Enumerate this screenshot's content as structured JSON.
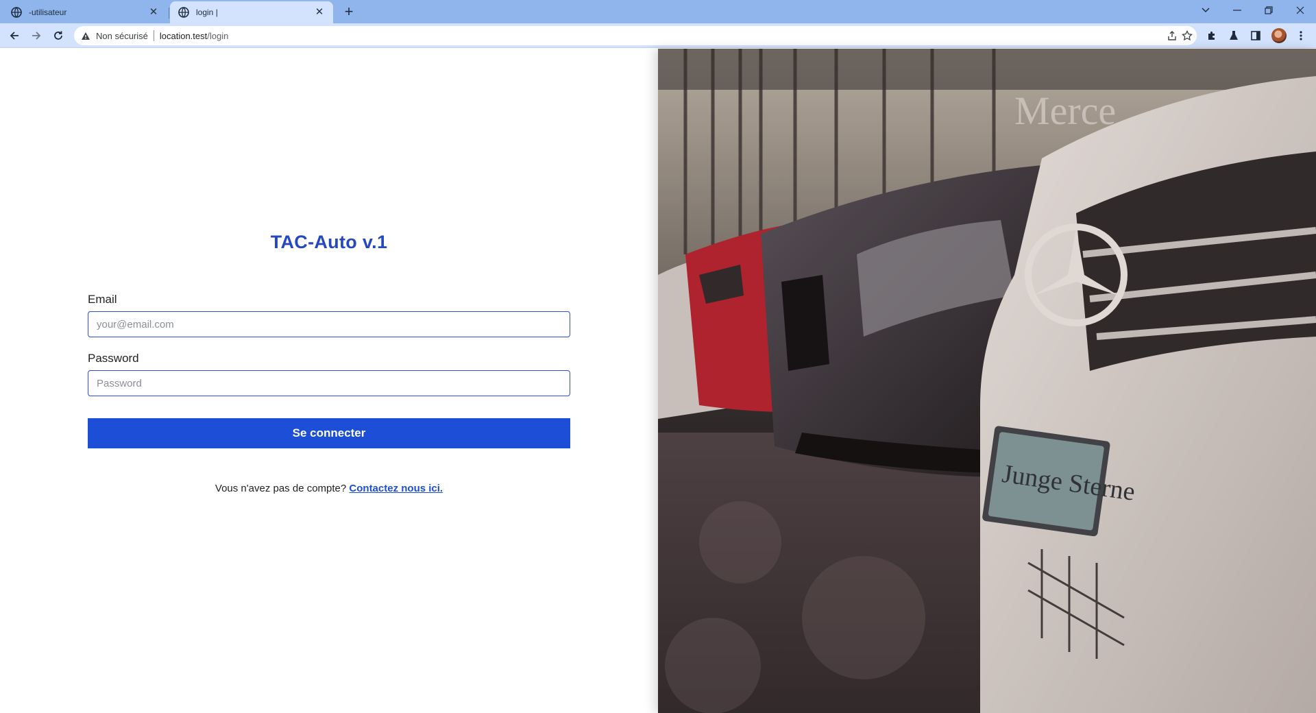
{
  "browser": {
    "tabs": [
      {
        "title": "-utilisateur",
        "active": false
      },
      {
        "title": "login |",
        "active": true
      }
    ],
    "address": {
      "security_label": "Non sécurisé",
      "host": "location.test",
      "path": "/login"
    }
  },
  "page": {
    "app_title": "TAC-Auto v.1",
    "email": {
      "label": "Email",
      "placeholder": "your@email.com",
      "value": ""
    },
    "password": {
      "label": "Password",
      "placeholder": "Password",
      "value": ""
    },
    "submit_label": "Se connecter",
    "signup_prompt": "Vous n'avez pas de compte?",
    "signup_link": "Contactez nous ici.",
    "hero_plate_text": "Junge Sterne",
    "hero_sign_text": "Merce"
  },
  "colors": {
    "accent": "#1d4ed8",
    "title": "#2448c2",
    "tab_strip": "#8fb5ec",
    "toolbar": "#d3e3fd"
  }
}
